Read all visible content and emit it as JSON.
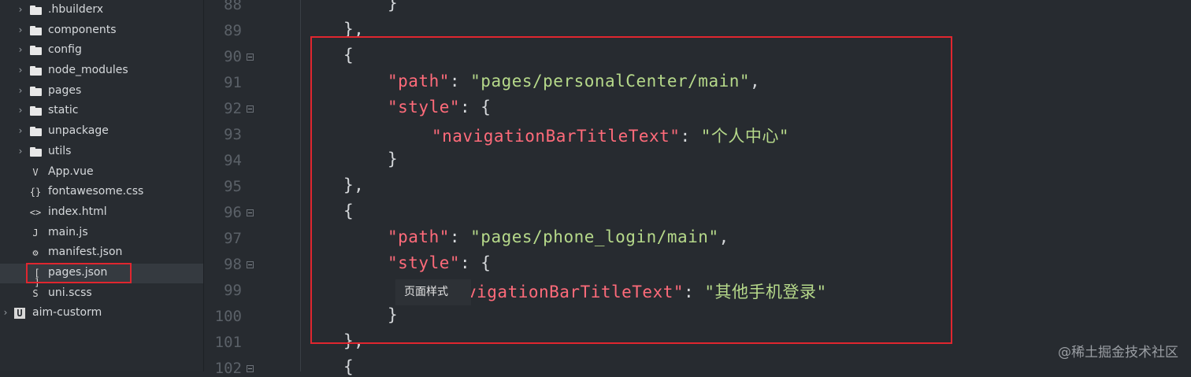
{
  "sidebar": {
    "items": [
      {
        "label": ".hbuilderx",
        "type": "folder",
        "expandable": true
      },
      {
        "label": "components",
        "type": "folder",
        "expandable": true
      },
      {
        "label": "config",
        "type": "folder",
        "expandable": true
      },
      {
        "label": "node_modules",
        "type": "folder",
        "expandable": true
      },
      {
        "label": "pages",
        "type": "folder",
        "expandable": true
      },
      {
        "label": "static",
        "type": "folder",
        "expandable": true
      },
      {
        "label": "unpackage",
        "type": "folder",
        "expandable": true
      },
      {
        "label": "utils",
        "type": "folder",
        "expandable": true
      },
      {
        "label": "App.vue",
        "type": "file",
        "icon_glyph": "V",
        "icon": "vue-file-icon"
      },
      {
        "label": "fontawesome.css",
        "type": "file",
        "icon_glyph": "{}",
        "icon": "css-file-icon"
      },
      {
        "label": "index.html",
        "type": "file",
        "icon_glyph": "<>",
        "icon": "html-file-icon"
      },
      {
        "label": "main.js",
        "type": "file",
        "icon_glyph": "J",
        "icon": "js-file-icon"
      },
      {
        "label": "manifest.json",
        "type": "file",
        "icon_glyph": "⚙",
        "icon": "manifest-file-icon"
      },
      {
        "label": "pages.json",
        "type": "file",
        "icon_glyph": "[ ]",
        "icon": "json-file-icon",
        "selected": true
      },
      {
        "label": "uni.scss",
        "type": "file",
        "icon_glyph": "S",
        "icon": "scss-file-icon"
      },
      {
        "label": "aim-custorm",
        "type": "project",
        "expandable": true,
        "icon_glyph": "U",
        "icon": "project-icon"
      }
    ]
  },
  "editor": {
    "line_numbers": [
      "88",
      "89",
      "90",
      "91",
      "92",
      "93",
      "94",
      "95",
      "96",
      "97",
      "98",
      "99",
      "100",
      "101",
      "102"
    ],
    "lines": {
      "l88": "}",
      "l89": "},",
      "l90": "{",
      "l91_key": "\"path\"",
      "l91_colon": ": ",
      "l91_val": "\"pages/personalCenter/main\"",
      "l91_end": ",",
      "l92_key": "\"style\"",
      "l92_rest": ": {",
      "l93_key": "\"navigationBarTitleText\"",
      "l93_colon": ": ",
      "l93_val": "\"个人中心\"",
      "l94": "}",
      "l95": "},",
      "l96": "{",
      "l97_key": "\"path\"",
      "l97_colon": ": ",
      "l97_val": "\"pages/phone_login/main\"",
      "l97_end": ",",
      "l98_key": "\"style\"",
      "l98_rest": ": {",
      "l99_key": "vigationBarTitleText\"",
      "l99_colon": ": ",
      "l99_val": "\"其他手机登录\"",
      "l100": "}",
      "l101": "},",
      "l102": "{"
    },
    "tooltip": "页面样式"
  },
  "watermark": "@稀土掘金技术社区",
  "colors": {
    "background": "#272b30",
    "keyword": "#ff6b7a",
    "string": "#b6d98a",
    "highlight_border": "#e0262f"
  }
}
